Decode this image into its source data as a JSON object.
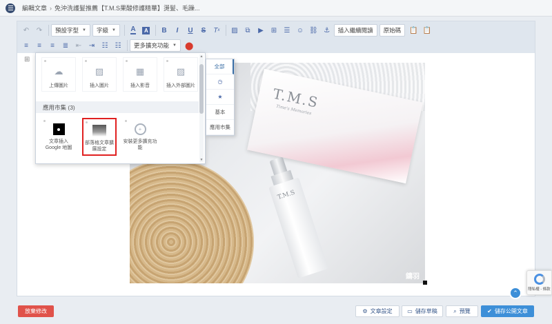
{
  "header": {
    "crumb_parent": "編輯文章",
    "crumb_current": "免沖洗護髮推薦【T.M.S果酸修護精華】燙髮、毛躁..."
  },
  "toolbar": {
    "font_family": "預設字型",
    "font_size": "字級",
    "insert_continue": "插入繼續閱讀",
    "source_code": "原始碼",
    "more_plugins": "更多擴充功能"
  },
  "panel": {
    "tiles": [
      {
        "label": "上傳圖片",
        "icon": "cloud-upload-icon"
      },
      {
        "label": "插入圖片",
        "icon": "image-icon"
      },
      {
        "label": "插入影音",
        "icon": "film-icon"
      },
      {
        "label": "插入外部圖片",
        "icon": "external-image-icon"
      }
    ],
    "section_title": "應用市集 (3)",
    "apps": [
      {
        "label": "文章插入 Google 地圖"
      },
      {
        "label": "部落格文章擴展設定"
      },
      {
        "label": "安裝更多擴充功能"
      }
    ]
  },
  "categories": {
    "all": "全部",
    "basic": "基本",
    "market": "應用市集"
  },
  "photo": {
    "box_brand": "T.M.S",
    "box_sub": "Time's Memories",
    "bottle_brand": "T.M.S",
    "watermark": "鑄羽"
  },
  "bottom": {
    "discard": "放棄修改",
    "settings": "文章設定",
    "save_draft": "儲存草稿",
    "preview": "預覽",
    "publish": "儲存公開文章"
  },
  "recaptcha": {
    "text": "隱私權 - 條款"
  }
}
